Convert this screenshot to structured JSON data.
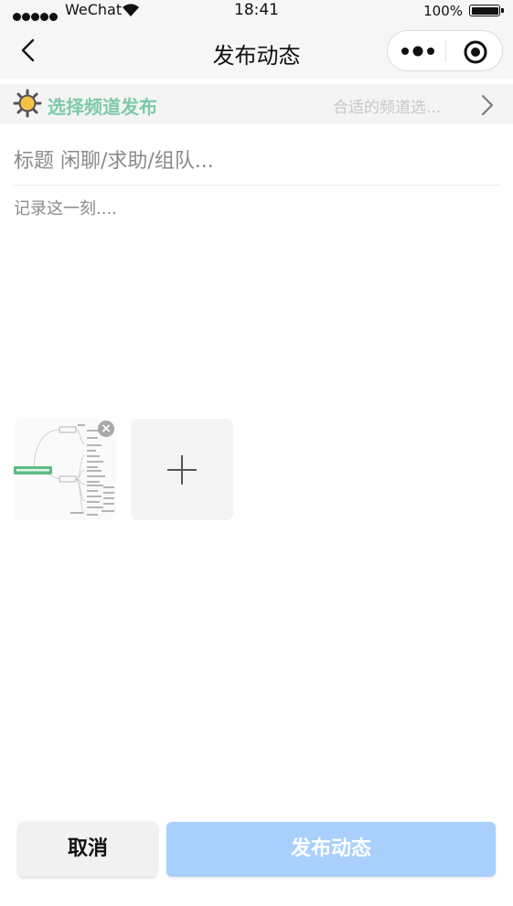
{
  "status_bar": {
    "carrier": "WeChat",
    "time": "18:41",
    "battery": "100%"
  },
  "nav": {
    "title": "发布动态",
    "back_icon": "chevron-left-icon",
    "more_icon": "more-dots-icon",
    "close_icon": "target-circle-icon"
  },
  "channel": {
    "icon": "sun-icon",
    "label": "选择频道发布",
    "placeholder": "合适的频道选...",
    "chevron_icon": "chevron-right-icon",
    "label_color": "#7ccaaa"
  },
  "post": {
    "title_placeholder": "标题 闲聊/求助/组队...",
    "content_placeholder": "记录这一刻...."
  },
  "images": {
    "remove_label": "×",
    "add_icon": "plus-icon"
  },
  "actions": {
    "cancel_label": "取消",
    "publish_label": "发布动态",
    "publish_color": "#a9d0fd"
  }
}
